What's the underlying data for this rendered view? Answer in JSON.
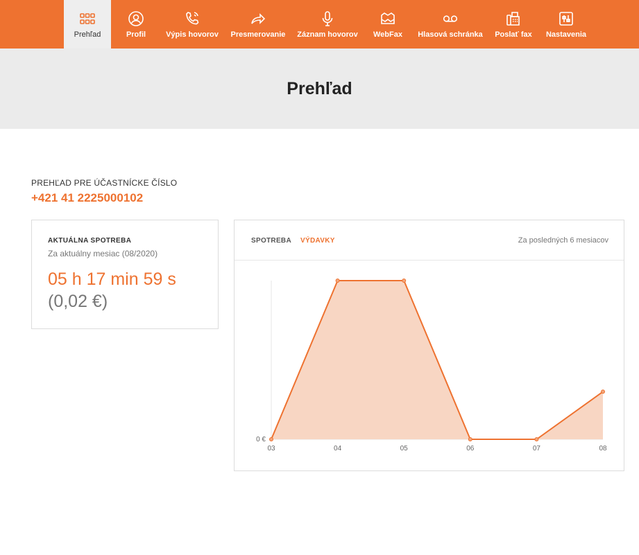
{
  "nav": {
    "items": [
      {
        "label": "Prehľad",
        "icon": "grid-icon",
        "active": true
      },
      {
        "label": "Profil",
        "icon": "user-icon",
        "active": false
      },
      {
        "label": "Výpis hovorov",
        "icon": "phone-icon",
        "active": false
      },
      {
        "label": "Presmerovanie",
        "icon": "forward-icon",
        "active": false
      },
      {
        "label": "Záznam hovorov",
        "icon": "microphone-icon",
        "active": false
      },
      {
        "label": "WebFax",
        "icon": "webfax-icon",
        "active": false
      },
      {
        "label": "Hlasová schránka",
        "icon": "voicemail-icon",
        "active": false
      },
      {
        "label": "Poslať fax",
        "icon": "fax-icon",
        "active": false
      },
      {
        "label": "Nastavenia",
        "icon": "settings-icon",
        "active": false
      }
    ]
  },
  "page": {
    "title": "Prehľad"
  },
  "subscriber": {
    "label": "PREHĽAD PRE ÚČASTNÍCKE ČÍSLO",
    "number": "+421 41 2225000102"
  },
  "usage_card": {
    "title": "AKTUÁLNA SPOTREBA",
    "subtitle": "Za aktuálny mesiac (08/2020)",
    "time": "05 h 17 min 59 s",
    "cost": "(0,02 €)"
  },
  "chart_card": {
    "tab_consumption": "SPOTREBA",
    "tab_expenses": "VÝDAVKY",
    "active_tab": "VÝDAVKY",
    "period": "Za posledných 6 mesiacov"
  },
  "colors": {
    "accent": "#ee7230",
    "area_fill": "#f8d6c3",
    "nav_active_bg": "#eeeeee"
  },
  "chart_data": {
    "type": "area",
    "categories": [
      "03",
      "04",
      "05",
      "06",
      "07",
      "08"
    ],
    "values": [
      0,
      1,
      1,
      0,
      0,
      0.3
    ],
    "y_tick_labels": [
      "0 €"
    ],
    "ylim": [
      0,
      1
    ],
    "grid": false
  }
}
